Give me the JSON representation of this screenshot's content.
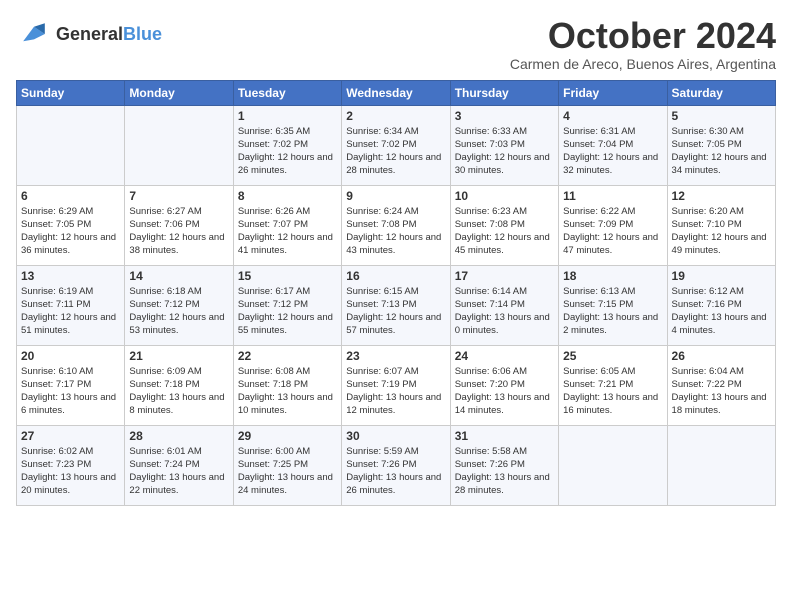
{
  "logo": {
    "line1": "General",
    "line2": "Blue"
  },
  "title": "October 2024",
  "location": "Carmen de Areco, Buenos Aires, Argentina",
  "days_of_week": [
    "Sunday",
    "Monday",
    "Tuesday",
    "Wednesday",
    "Thursday",
    "Friday",
    "Saturday"
  ],
  "weeks": [
    [
      {
        "day": "",
        "info": ""
      },
      {
        "day": "",
        "info": ""
      },
      {
        "day": "1",
        "info": "Sunrise: 6:35 AM\nSunset: 7:02 PM\nDaylight: 12 hours\nand 26 minutes."
      },
      {
        "day": "2",
        "info": "Sunrise: 6:34 AM\nSunset: 7:02 PM\nDaylight: 12 hours\nand 28 minutes."
      },
      {
        "day": "3",
        "info": "Sunrise: 6:33 AM\nSunset: 7:03 PM\nDaylight: 12 hours\nand 30 minutes."
      },
      {
        "day": "4",
        "info": "Sunrise: 6:31 AM\nSunset: 7:04 PM\nDaylight: 12 hours\nand 32 minutes."
      },
      {
        "day": "5",
        "info": "Sunrise: 6:30 AM\nSunset: 7:05 PM\nDaylight: 12 hours\nand 34 minutes."
      }
    ],
    [
      {
        "day": "6",
        "info": "Sunrise: 6:29 AM\nSunset: 7:05 PM\nDaylight: 12 hours\nand 36 minutes."
      },
      {
        "day": "7",
        "info": "Sunrise: 6:27 AM\nSunset: 7:06 PM\nDaylight: 12 hours\nand 38 minutes."
      },
      {
        "day": "8",
        "info": "Sunrise: 6:26 AM\nSunset: 7:07 PM\nDaylight: 12 hours\nand 41 minutes."
      },
      {
        "day": "9",
        "info": "Sunrise: 6:24 AM\nSunset: 7:08 PM\nDaylight: 12 hours\nand 43 minutes."
      },
      {
        "day": "10",
        "info": "Sunrise: 6:23 AM\nSunset: 7:08 PM\nDaylight: 12 hours\nand 45 minutes."
      },
      {
        "day": "11",
        "info": "Sunrise: 6:22 AM\nSunset: 7:09 PM\nDaylight: 12 hours\nand 47 minutes."
      },
      {
        "day": "12",
        "info": "Sunrise: 6:20 AM\nSunset: 7:10 PM\nDaylight: 12 hours\nand 49 minutes."
      }
    ],
    [
      {
        "day": "13",
        "info": "Sunrise: 6:19 AM\nSunset: 7:11 PM\nDaylight: 12 hours\nand 51 minutes."
      },
      {
        "day": "14",
        "info": "Sunrise: 6:18 AM\nSunset: 7:12 PM\nDaylight: 12 hours\nand 53 minutes."
      },
      {
        "day": "15",
        "info": "Sunrise: 6:17 AM\nSunset: 7:12 PM\nDaylight: 12 hours\nand 55 minutes."
      },
      {
        "day": "16",
        "info": "Sunrise: 6:15 AM\nSunset: 7:13 PM\nDaylight: 12 hours\nand 57 minutes."
      },
      {
        "day": "17",
        "info": "Sunrise: 6:14 AM\nSunset: 7:14 PM\nDaylight: 13 hours\nand 0 minutes."
      },
      {
        "day": "18",
        "info": "Sunrise: 6:13 AM\nSunset: 7:15 PM\nDaylight: 13 hours\nand 2 minutes."
      },
      {
        "day": "19",
        "info": "Sunrise: 6:12 AM\nSunset: 7:16 PM\nDaylight: 13 hours\nand 4 minutes."
      }
    ],
    [
      {
        "day": "20",
        "info": "Sunrise: 6:10 AM\nSunset: 7:17 PM\nDaylight: 13 hours\nand 6 minutes."
      },
      {
        "day": "21",
        "info": "Sunrise: 6:09 AM\nSunset: 7:18 PM\nDaylight: 13 hours\nand 8 minutes."
      },
      {
        "day": "22",
        "info": "Sunrise: 6:08 AM\nSunset: 7:18 PM\nDaylight: 13 hours\nand 10 minutes."
      },
      {
        "day": "23",
        "info": "Sunrise: 6:07 AM\nSunset: 7:19 PM\nDaylight: 13 hours\nand 12 minutes."
      },
      {
        "day": "24",
        "info": "Sunrise: 6:06 AM\nSunset: 7:20 PM\nDaylight: 13 hours\nand 14 minutes."
      },
      {
        "day": "25",
        "info": "Sunrise: 6:05 AM\nSunset: 7:21 PM\nDaylight: 13 hours\nand 16 minutes."
      },
      {
        "day": "26",
        "info": "Sunrise: 6:04 AM\nSunset: 7:22 PM\nDaylight: 13 hours\nand 18 minutes."
      }
    ],
    [
      {
        "day": "27",
        "info": "Sunrise: 6:02 AM\nSunset: 7:23 PM\nDaylight: 13 hours\nand 20 minutes."
      },
      {
        "day": "28",
        "info": "Sunrise: 6:01 AM\nSunset: 7:24 PM\nDaylight: 13 hours\nand 22 minutes."
      },
      {
        "day": "29",
        "info": "Sunrise: 6:00 AM\nSunset: 7:25 PM\nDaylight: 13 hours\nand 24 minutes."
      },
      {
        "day": "30",
        "info": "Sunrise: 5:59 AM\nSunset: 7:26 PM\nDaylight: 13 hours\nand 26 minutes."
      },
      {
        "day": "31",
        "info": "Sunrise: 5:58 AM\nSunset: 7:26 PM\nDaylight: 13 hours\nand 28 minutes."
      },
      {
        "day": "",
        "info": ""
      },
      {
        "day": "",
        "info": ""
      }
    ]
  ]
}
